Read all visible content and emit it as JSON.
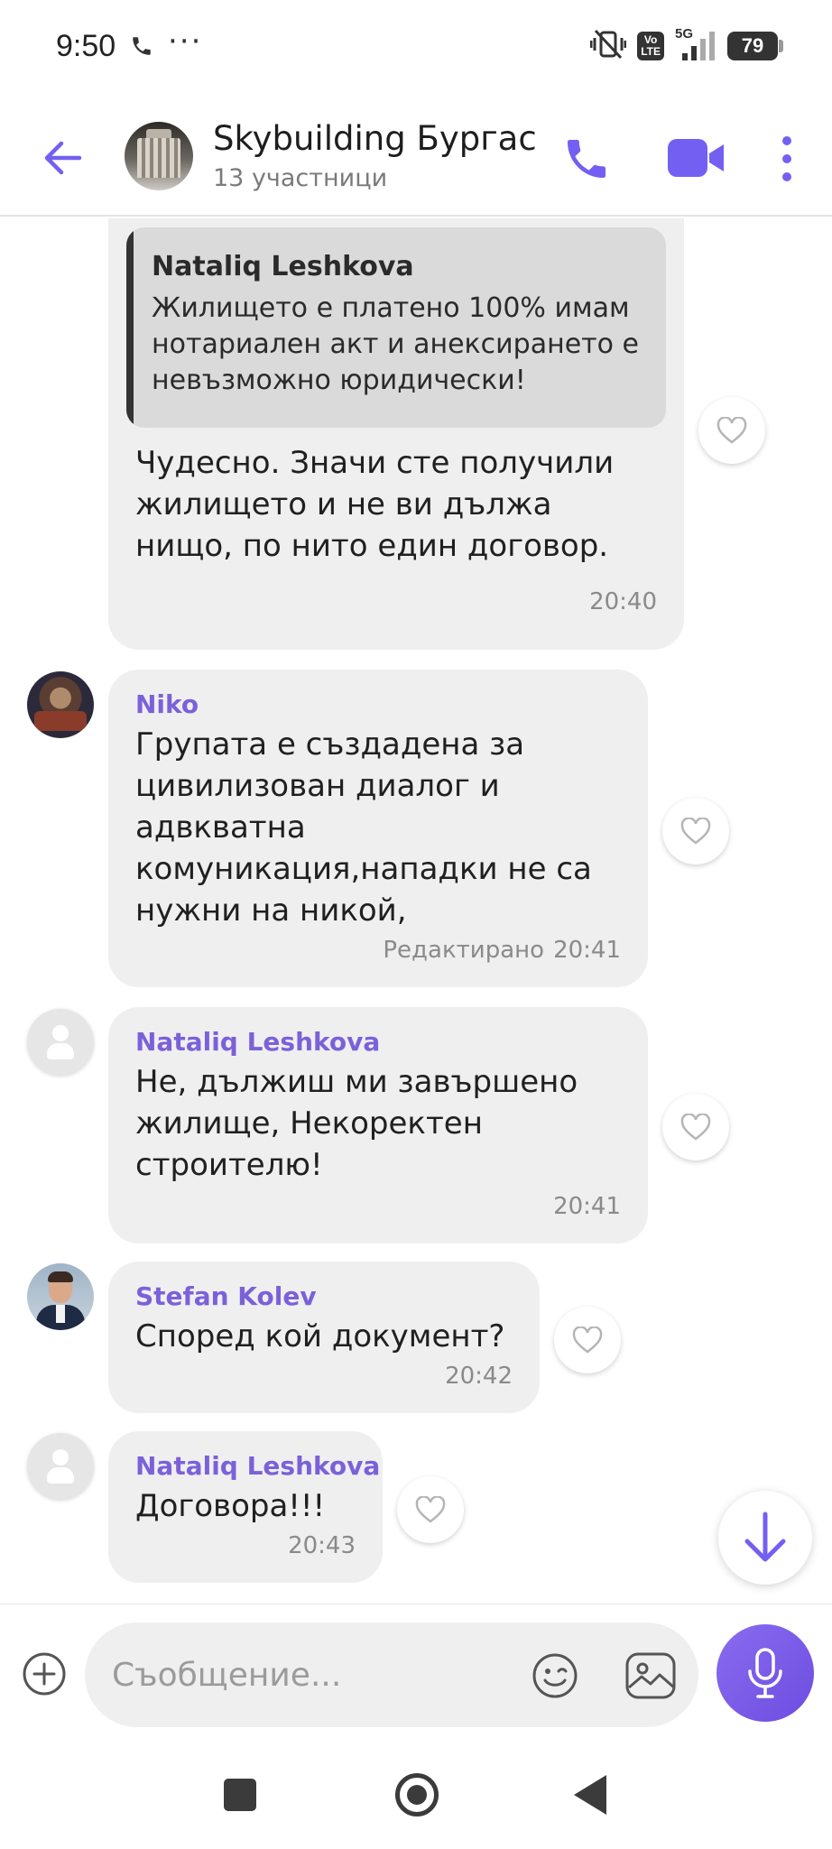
{
  "status_bar": {
    "time": "9:50",
    "dots": "···",
    "volte_top": "Vo",
    "volte_bottom": "LTE",
    "network": "5G",
    "battery": "79"
  },
  "header": {
    "title": "Skybuilding Бургас",
    "subtitle": "13 участници"
  },
  "messages": [
    {
      "quote_author": "Nataliq Leshkova",
      "quote_text": "Жилището е платено 100% имам нотариален акт и анексирането е невъзможно юридически!",
      "text": "Чудесно. Значи сте получили жилището и не ви дължа нищо, по нито един договор.",
      "time": "20:40"
    },
    {
      "sender": "Niko",
      "text": "Групата е създадена за цивилизован диалог и адвкватна комуникация,нападки не са нужни на никой,",
      "edited": "Редактирано",
      "time": "20:41"
    },
    {
      "sender": "Nataliq Leshkova",
      "text": "Не, дължиш ми завършено жилище, Некоректен строителю!",
      "time": "20:41"
    },
    {
      "sender": "Stefan Kolev",
      "text": "Според кой документ?",
      "time": "20:42"
    },
    {
      "sender": "Nataliq Leshkova",
      "text": "Договора!!!",
      "time": "20:43"
    }
  ],
  "composer": {
    "placeholder": "Съобщение..."
  },
  "colors": {
    "accent": "#7360f2",
    "bubble": "#efefef",
    "sender": "#7b61d9"
  },
  "icons": [
    "back-arrow-icon",
    "phone-icon",
    "video-camera-icon",
    "more-vertical-icon",
    "heart-icon",
    "arrow-down-icon",
    "plus-circle-icon",
    "emoji-icon",
    "gallery-icon",
    "microphone-icon"
  ]
}
